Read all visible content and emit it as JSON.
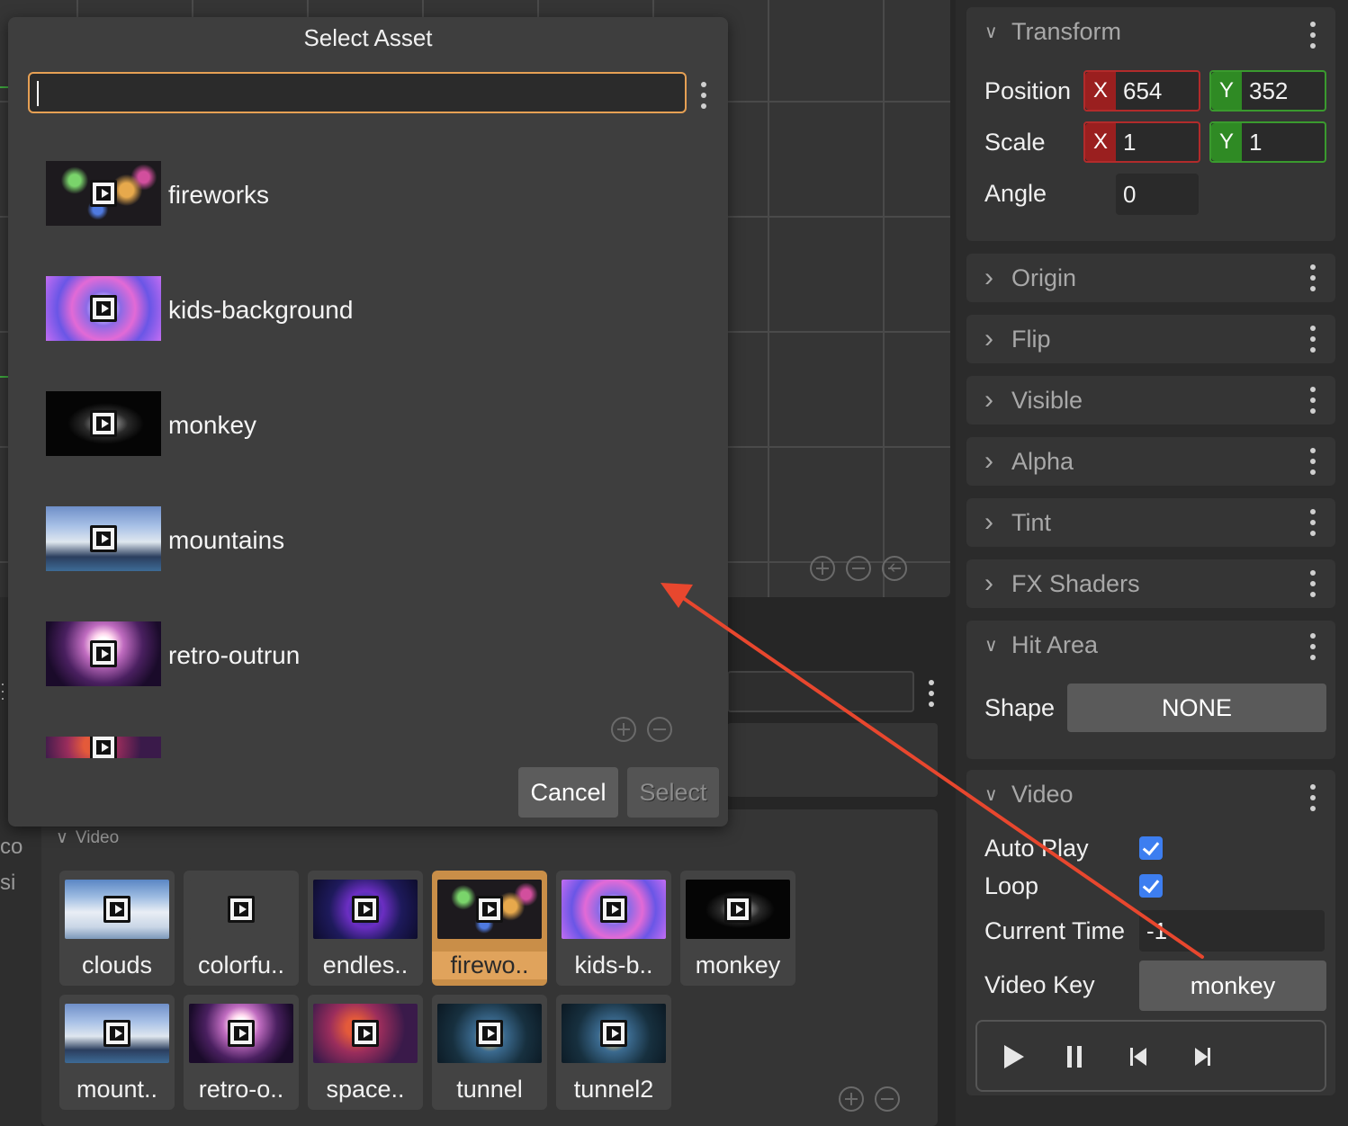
{
  "dialog": {
    "title": "Select Asset",
    "search_value": "",
    "items": [
      {
        "label": "fireworks",
        "thumb": "th-fireworks"
      },
      {
        "label": "kids-background",
        "thumb": "th-kids"
      },
      {
        "label": "monkey",
        "thumb": "th-monkey"
      },
      {
        "label": "mountains",
        "thumb": "th-mountains"
      },
      {
        "label": "retro-outrun",
        "thumb": "th-retro"
      },
      {
        "label": "",
        "thumb": "th-space"
      }
    ],
    "cancel_label": "Cancel",
    "select_label": "Select"
  },
  "left_strip": {
    "text1": "co",
    "text2": "si"
  },
  "asset_browser": {
    "section_label": "Video",
    "tiles": [
      {
        "label": "clouds",
        "thumb": "th-clouds",
        "selected": false
      },
      {
        "label": "colorfu..",
        "thumb": "th-colorful",
        "selected": false
      },
      {
        "label": "endles..",
        "thumb": "th-endless",
        "selected": false
      },
      {
        "label": "firewo..",
        "thumb": "th-fireworks",
        "selected": true
      },
      {
        "label": "kids-b..",
        "thumb": "th-kids",
        "selected": false
      },
      {
        "label": "monkey",
        "thumb": "th-monkey",
        "selected": false
      },
      {
        "label": "mount..",
        "thumb": "th-mountains",
        "selected": false
      },
      {
        "label": "retro-o..",
        "thumb": "th-retro",
        "selected": false
      },
      {
        "label": "space..",
        "thumb": "th-space",
        "selected": false
      },
      {
        "label": "tunnel",
        "thumb": "th-tunnel",
        "selected": false
      },
      {
        "label": "tunnel2",
        "thumb": "th-tunnel",
        "selected": false
      }
    ]
  },
  "inspector": {
    "transform": {
      "title": "Transform",
      "position_label": "Position",
      "scale_label": "Scale",
      "angle_label": "Angle",
      "x_axis": "X",
      "y_axis": "Y",
      "position_x": "654",
      "position_y": "352",
      "scale_x": "1",
      "scale_y": "1",
      "angle": "0"
    },
    "collapsed_sections": [
      "Origin",
      "Flip",
      "Visible",
      "Alpha",
      "Tint",
      "FX Shaders"
    ],
    "hit_area": {
      "title": "Hit Area",
      "shape_label": "Shape",
      "shape_value": "NONE"
    },
    "video": {
      "title": "Video",
      "auto_play_label": "Auto Play",
      "auto_play": true,
      "loop_label": "Loop",
      "loop": true,
      "current_time_label": "Current Time",
      "current_time": "-1",
      "video_key_label": "Video Key",
      "video_key": "monkey"
    }
  },
  "colors": {
    "accent_orange": "#e6a054",
    "axis_x": "#9a1f1f",
    "axis_y": "#2f8a24",
    "checkbox": "#3d7ef0",
    "annotation_arrow": "#e8472e"
  }
}
